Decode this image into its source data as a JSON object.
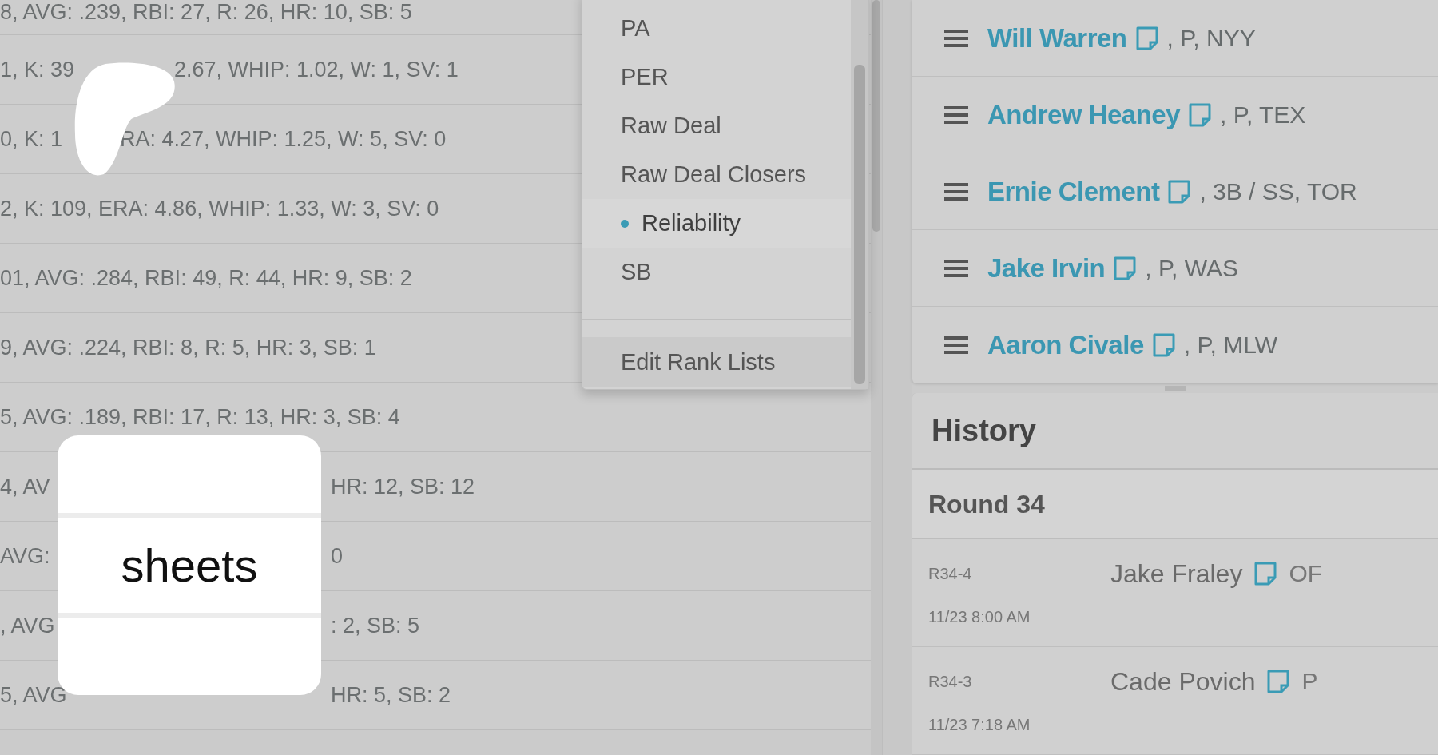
{
  "stat_rows": [
    {
      "text": "8, AVG: .239, RBI: 27, R: 26, HR: 10, SB: 5"
    },
    {
      "text": "1, K: 39",
      "rest": "2.67, WHIP: 1.02, W: 1, SV: 1"
    },
    {
      "text": "0, K: 1",
      "rest": "RA: 4.27, WHIP: 1.25, W: 5, SV: 0"
    },
    {
      "text": "2, K: 109, ERA: 4.86, WHIP: 1.33, W: 3, SV: 0"
    },
    {
      "text": "01, AVG: .284, RBI: 49, R: 44, HR: 9, SB: 2"
    },
    {
      "text": "9, AVG: .224, RBI: 8, R: 5, HR: 3, SB: 1"
    },
    {
      "text": "5, AVG: .189, RBI: 17, R: 13, HR: 3, SB: 4"
    },
    {
      "text": "4, AV",
      "rest": "HR: 12, SB: 12"
    },
    {
      "text": "AVG:",
      "rest": "0"
    },
    {
      "text": ", AVG",
      "rest": ": 2, SB: 5"
    },
    {
      "text": "5, AVG",
      "rest": "HR: 5, SB: 2"
    }
  ],
  "rank_menu": {
    "items": [
      {
        "label": "PA",
        "selected": false
      },
      {
        "label": "PER",
        "selected": false
      },
      {
        "label": "Raw Deal",
        "selected": false
      },
      {
        "label": "Raw Deal Closers",
        "selected": false
      },
      {
        "label": "Reliability",
        "selected": true
      },
      {
        "label": "SB",
        "selected": false
      }
    ],
    "footer": "Edit Rank Lists"
  },
  "queue": [
    {
      "name": "Will Warren",
      "details": ", P, NYY"
    },
    {
      "name": "Andrew Heaney",
      "details": ", P, TEX"
    },
    {
      "name": "Ernie Clement",
      "details": ", 3B / SS, TOR"
    },
    {
      "name": "Jake Irvin",
      "details": ", P, WAS"
    },
    {
      "name": "Aaron Civale",
      "details": ", P, MLW"
    }
  ],
  "history": {
    "title": "History",
    "round": "Round 34",
    "picks": [
      {
        "pick": "R34-4",
        "time": "11/23 8:00 AM",
        "player": "Jake Fraley",
        "position": "OF"
      },
      {
        "pick": "R34-3",
        "time": "11/23 7:18 AM",
        "player": "Cade Povich",
        "position": "P"
      }
    ]
  },
  "overlay_card": {
    "label": "sheets"
  }
}
